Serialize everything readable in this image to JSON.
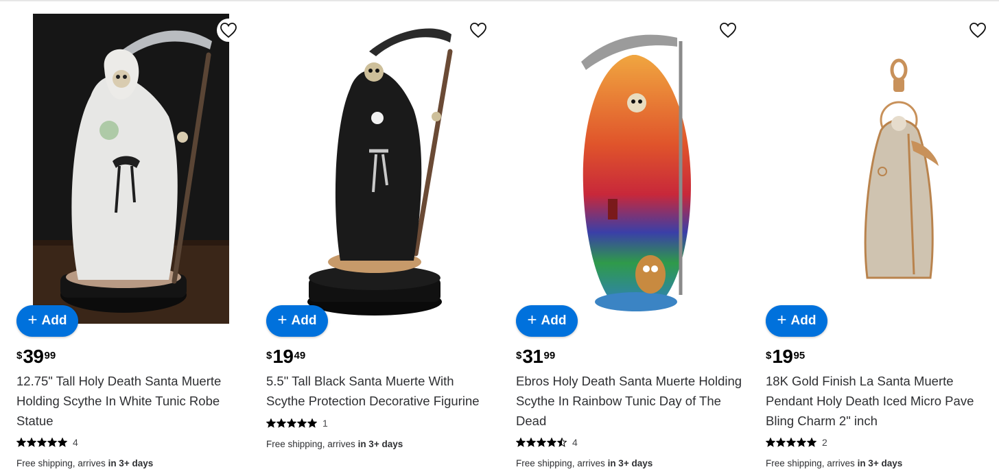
{
  "products": [
    {
      "add_label": "Add",
      "price": {
        "currency": "$",
        "dollars": "39",
        "cents": "99"
      },
      "title": "12.75\" Tall Holy Death Santa Muerte Holding Scythe In White Tunic Robe Statue",
      "rating": {
        "stars": 5,
        "count": "4"
      },
      "shipping": {
        "prefix": "Free shipping, arrives ",
        "emphasis": "in 3+ days"
      },
      "image_alt": "White robed Santa Muerte statue with scythe"
    },
    {
      "add_label": "Add",
      "price": {
        "currency": "$",
        "dollars": "19",
        "cents": "49"
      },
      "title": "5.5\" Tall Black Santa Muerte With Scythe Protection Decorative Figurine",
      "rating": {
        "stars": 5,
        "count": "1"
      },
      "shipping": {
        "prefix": "Free shipping, arrives ",
        "emphasis": "in 3+ days"
      },
      "image_alt": "Black robed Santa Muerte figurine with scythe"
    },
    {
      "add_label": "Add",
      "price": {
        "currency": "$",
        "dollars": "31",
        "cents": "99"
      },
      "title": "Ebros Holy Death Santa Muerte Holding Scythe In Rainbow Tunic Day of The Dead",
      "rating": {
        "stars": 4.5,
        "count": "4"
      },
      "shipping": {
        "prefix": "Free shipping, arrives ",
        "emphasis": "in 3+ days"
      },
      "image_alt": "Rainbow robed Santa Muerte statue with owl"
    },
    {
      "add_label": "Add",
      "price": {
        "currency": "$",
        "dollars": "19",
        "cents": "95"
      },
      "title": "18K Gold Finish La Santa Muerte Pendant Holy Death Iced Micro Pave Bling Charm 2\" inch",
      "rating": {
        "stars": 5,
        "count": "2"
      },
      "shipping": {
        "prefix": "Free shipping, arrives ",
        "emphasis": "in 3+ days"
      },
      "image_alt": "Gold Santa Muerte pendant"
    }
  ],
  "icons": {
    "favorite": "heart-outline-icon",
    "add": "plus-icon",
    "rating": "star-icon"
  },
  "colors": {
    "accent": "#0071dc",
    "star": "#000000",
    "text": "#2e2f32"
  }
}
